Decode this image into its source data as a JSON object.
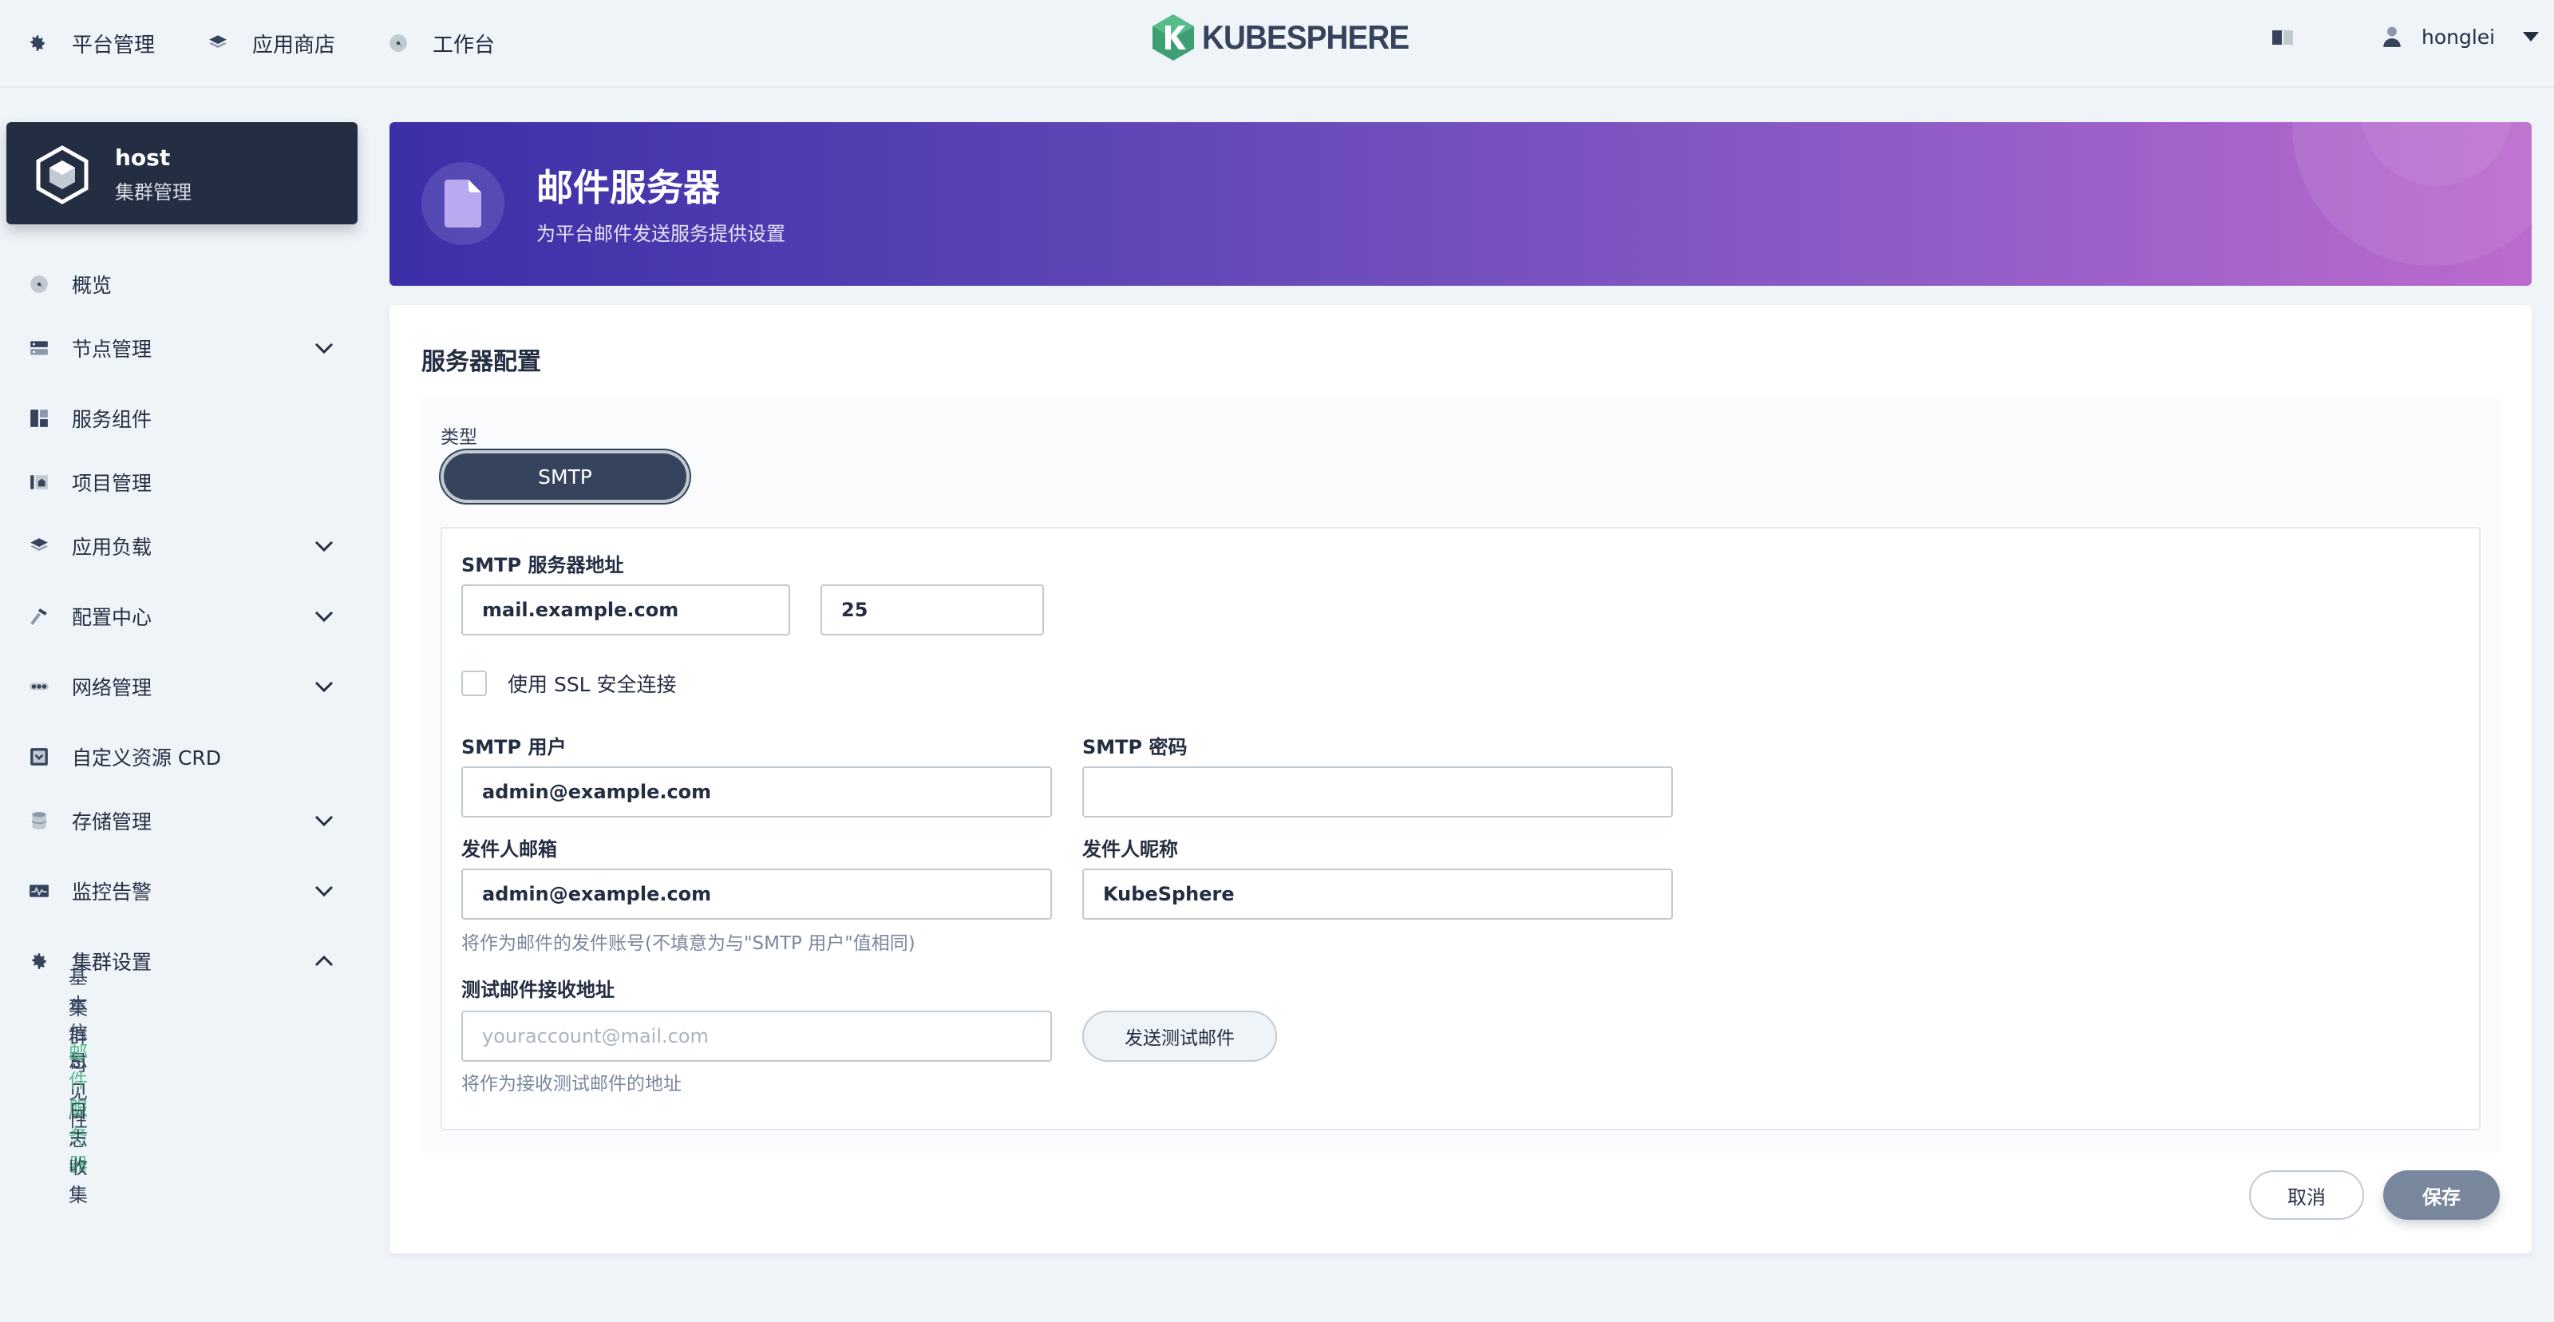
{
  "topnav": {
    "items": [
      {
        "label": "平台管理",
        "icon": "gear-icon"
      },
      {
        "label": "应用商店",
        "icon": "layers-icon"
      },
      {
        "label": "工作台",
        "icon": "dashboard-icon"
      }
    ],
    "logo_text": "KUBESPHERE",
    "user": "honglei"
  },
  "sidebar": {
    "cluster": {
      "name": "host",
      "subtitle": "集群管理"
    },
    "items": [
      {
        "label": "概览",
        "icon": "dashboard-icon",
        "expandable": false
      },
      {
        "label": "节点管理",
        "icon": "server-icon",
        "expandable": true
      },
      {
        "label": "服务组件",
        "icon": "components-icon",
        "expandable": false
      },
      {
        "label": "项目管理",
        "icon": "project-icon",
        "expandable": false
      },
      {
        "label": "应用负载",
        "icon": "layers-icon",
        "expandable": true
      },
      {
        "label": "配置中心",
        "icon": "hammer-icon",
        "expandable": true
      },
      {
        "label": "网络管理",
        "icon": "network-icon",
        "expandable": true
      },
      {
        "label": "自定义资源 CRD",
        "icon": "crd-icon",
        "expandable": false
      },
      {
        "label": "存储管理",
        "icon": "database-icon",
        "expandable": true
      },
      {
        "label": "监控告警",
        "icon": "monitor-icon",
        "expandable": true
      },
      {
        "label": "集群设置",
        "icon": "gear-icon",
        "expandable": true,
        "expanded": true
      }
    ],
    "subitems": [
      {
        "label": "基本信息",
        "active": false
      },
      {
        "label": "集群可见性",
        "active": false
      },
      {
        "label": "邮件服务器",
        "active": true
      },
      {
        "label": "日志收集",
        "active": false
      }
    ]
  },
  "banner": {
    "title": "邮件服务器",
    "description": "为平台邮件发送服务提供设置"
  },
  "form": {
    "section_title": "服务器配置",
    "type_label": "类型",
    "type_value": "SMTP",
    "server_label": "SMTP 服务器地址",
    "server_value": "mail.example.com",
    "port_value": "25",
    "ssl_label": "使用 SSL 安全连接",
    "ssl_checked": false,
    "user_label": "SMTP 用户",
    "user_value": "admin@example.com",
    "password_label": "SMTP 密码",
    "password_value": "",
    "sender_email_label": "发件人邮箱",
    "sender_email_value": "admin@example.com",
    "sender_name_label": "发件人昵称",
    "sender_name_value": "KubeSphere",
    "sender_hint": "将作为邮件的发件账号(不填意为与\"SMTP 用户\"值相同)",
    "test_label": "测试邮件接收地址",
    "test_placeholder": "youraccount@mail.com",
    "test_button": "发送测试邮件",
    "test_hint": "将作为接收测试邮件的地址"
  },
  "actions": {
    "cancel": "取消",
    "save": "保存"
  },
  "colors": {
    "dark": "#242e42",
    "accent_green": "#55bc8a",
    "save_button": "#79879c",
    "banner_start": "#3b2fa8",
    "banner_end": "#bb6acd"
  }
}
